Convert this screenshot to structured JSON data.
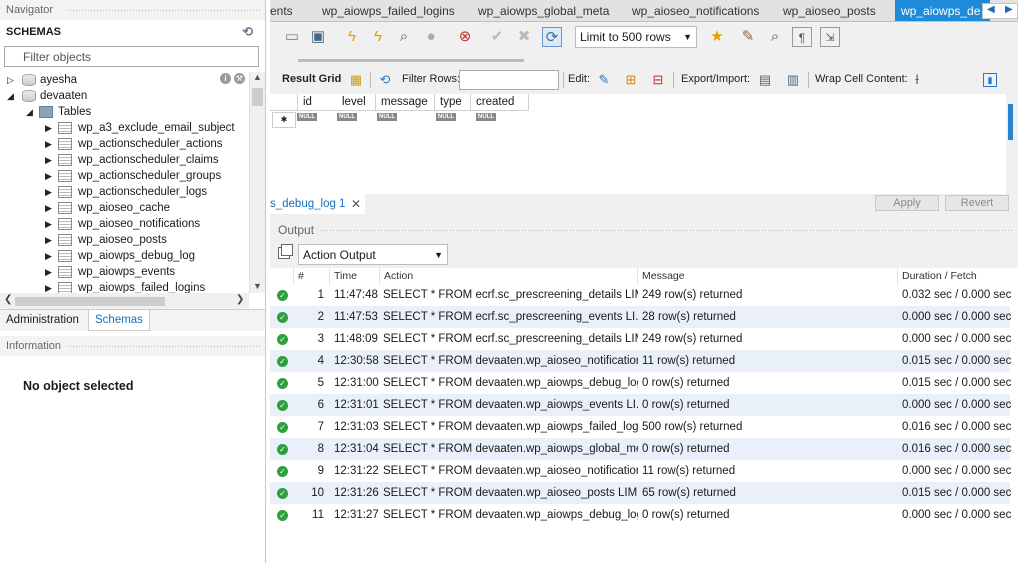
{
  "navigator": {
    "title": "Navigator",
    "schemas_label": "SCHEMAS",
    "filter_placeholder": "Filter objects",
    "tree": [
      {
        "label": "ayesha",
        "kind": "schema",
        "expanded": false
      },
      {
        "label": "devaaten",
        "kind": "schema",
        "expanded": true
      },
      {
        "label": "Tables",
        "kind": "folder",
        "expanded": true
      },
      {
        "label": "wp_a3_exclude_email_subject",
        "kind": "table"
      },
      {
        "label": "wp_actionscheduler_actions",
        "kind": "table"
      },
      {
        "label": "wp_actionscheduler_claims",
        "kind": "table"
      },
      {
        "label": "wp_actionscheduler_groups",
        "kind": "table"
      },
      {
        "label": "wp_actionscheduler_logs",
        "kind": "table"
      },
      {
        "label": "wp_aioseo_cache",
        "kind": "table"
      },
      {
        "label": "wp_aioseo_notifications",
        "kind": "table"
      },
      {
        "label": "wp_aioseo_posts",
        "kind": "table"
      },
      {
        "label": "wp_aiowps_debug_log",
        "kind": "table"
      },
      {
        "label": "wp_aiowps_events",
        "kind": "table"
      },
      {
        "label": "wp_aiowps_failed_logins",
        "kind": "table"
      }
    ],
    "tabs": {
      "administration": "Administration",
      "schemas": "Schemas"
    },
    "info_title": "Information",
    "no_object": "No object selected"
  },
  "editor_tabs": [
    "ents",
    "wp_aiowps_failed_logins",
    "wp_aiowps_global_meta",
    "wp_aioseo_notifications",
    "wp_aioseo_posts",
    "wp_aiowps_de"
  ],
  "toolbar": {
    "limit_label": "Limit to 500 rows"
  },
  "gridbar": {
    "result_grid": "Result Grid",
    "filter_rows": "Filter Rows:",
    "edit": "Edit:",
    "export_import": "Export/Import:",
    "wrap": "Wrap Cell Content:"
  },
  "grid": {
    "columns": [
      "id",
      "level",
      "message",
      "type",
      "created"
    ],
    "null_text": "NULL"
  },
  "result_tab": {
    "label": "s_debug_log 1",
    "apply": "Apply",
    "revert": "Revert"
  },
  "output": {
    "title": "Output",
    "selector": "Action Output",
    "headers": {
      "num": "#",
      "time": "Time",
      "action": "Action",
      "message": "Message",
      "duration": "Duration / Fetch"
    },
    "rows": [
      {
        "num": "1",
        "time": "11:47:48",
        "action": "SELECT * FROM ecrf.sc_prescreening_details LIM...",
        "message": "249 row(s) returned",
        "duration": "0.032 sec / 0.000 sec"
      },
      {
        "num": "2",
        "time": "11:47:53",
        "action": "SELECT * FROM ecrf.sc_prescreening_events LI...",
        "message": "28 row(s) returned",
        "duration": "0.000 sec / 0.000 sec"
      },
      {
        "num": "3",
        "time": "11:48:09",
        "action": "SELECT * FROM ecrf.sc_prescreening_details LIM...",
        "message": "249 row(s) returned",
        "duration": "0.000 sec / 0.000 sec"
      },
      {
        "num": "4",
        "time": "12:30:58",
        "action": "SELECT * FROM devaaten.wp_aioseo_notification...",
        "message": "11 row(s) returned",
        "duration": "0.015 sec / 0.000 sec"
      },
      {
        "num": "5",
        "time": "12:31:00",
        "action": "SELECT * FROM devaaten.wp_aiowps_debug_log...",
        "message": "0 row(s) returned",
        "duration": "0.015 sec / 0.000 sec"
      },
      {
        "num": "6",
        "time": "12:31:01",
        "action": "SELECT * FROM devaaten.wp_aiowps_events LI...",
        "message": "0 row(s) returned",
        "duration": "0.000 sec / 0.000 sec"
      },
      {
        "num": "7",
        "time": "12:31:03",
        "action": "SELECT * FROM devaaten.wp_aiowps_failed_logi...",
        "message": "500 row(s) returned",
        "duration": "0.016 sec / 0.000 sec"
      },
      {
        "num": "8",
        "time": "12:31:04",
        "action": "SELECT * FROM devaaten.wp_aiowps_global_me...",
        "message": "0 row(s) returned",
        "duration": "0.016 sec / 0.000 sec"
      },
      {
        "num": "9",
        "time": "12:31:22",
        "action": "SELECT * FROM devaaten.wp_aioseo_notification...",
        "message": "11 row(s) returned",
        "duration": "0.000 sec / 0.000 sec"
      },
      {
        "num": "10",
        "time": "12:31:26",
        "action": "SELECT * FROM devaaten.wp_aioseo_posts LIMI...",
        "message": "65 row(s) returned",
        "duration": "0.015 sec / 0.000 sec"
      },
      {
        "num": "11",
        "time": "12:31:27",
        "action": "SELECT * FROM devaaten.wp_aiowps_debug_log...",
        "message": "0 row(s) returned",
        "duration": "0.000 sec / 0.000 sec"
      }
    ]
  },
  "colors": {
    "accent": "#1e8ad8",
    "success": "#2e9e3e",
    "row_alt": "#e9f0fa"
  }
}
